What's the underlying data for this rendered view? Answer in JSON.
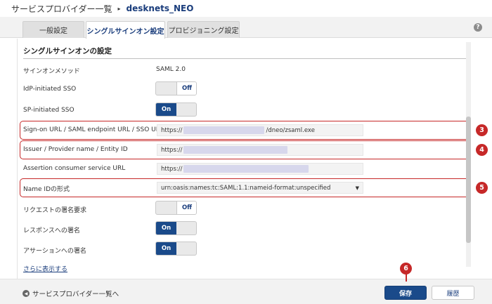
{
  "breadcrumb": {
    "root": "サービスプロバイダー一覧",
    "separator": "▸",
    "current": "desknets_NEO"
  },
  "tabs": [
    {
      "label": "一般設定",
      "active": false
    },
    {
      "label": "シングルサインオン設定",
      "active": true
    },
    {
      "label": "プロビジョニング設定",
      "active": false
    }
  ],
  "help_icon": "question-circle-icon",
  "section": {
    "title": "シングルサインオンの設定"
  },
  "rows": {
    "signon_method": {
      "label": "サインオンメソッド",
      "value": "SAML 2.0"
    },
    "idp_sso": {
      "label": "IdP-initiated SSO",
      "state": "Off"
    },
    "sp_sso": {
      "label": "SP-initiated SSO",
      "state": "On"
    },
    "signon_url": {
      "label": "Sign-on URL / SAML endpoint URL / SSO URL*",
      "prefix": "https://",
      "suffix": "/dneo/zsaml.exe"
    },
    "issuer": {
      "label": "Issuer / Provider name / Entity ID",
      "prefix": "https://"
    },
    "acs_url": {
      "label": "Assertion consumer service URL",
      "prefix": "https://"
    },
    "nameid": {
      "label": "Name IDの形式",
      "value": "urn:oasis:names:tc:SAML:1.1:nameid-format:unspecified"
    },
    "request_sign": {
      "label": "リクエストの署名要求",
      "state": "Off"
    },
    "response_sign": {
      "label": "レスポンスへの署名",
      "state": "On"
    },
    "assertion_sign": {
      "label": "アサーションへの署名",
      "state": "On"
    }
  },
  "show_more": "さらに表示する",
  "callouts": {
    "c3": "3",
    "c4": "4",
    "c5": "5",
    "c6": "6"
  },
  "footer": {
    "back": "サービスプロバイダー一覧へ",
    "save": "保存",
    "history": "履歴"
  },
  "colors": {
    "accent": "#1a4a8a",
    "callout": "#c62828",
    "link": "#1a3d7c"
  }
}
